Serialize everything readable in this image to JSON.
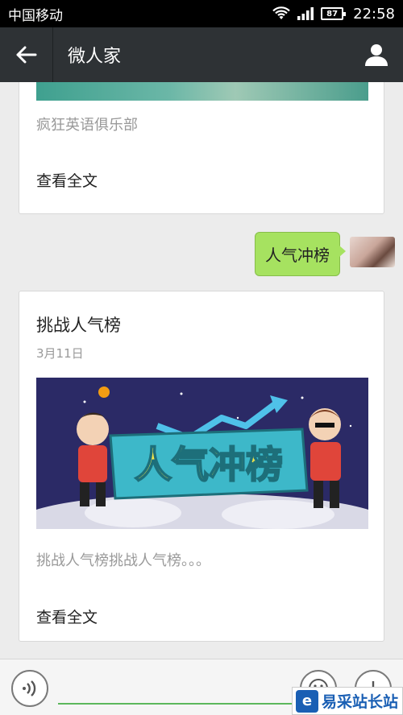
{
  "status_bar": {
    "carrier": "中国移动",
    "battery": "87",
    "time": "22:58"
  },
  "title_bar": {
    "title": "微人家",
    "back_icon": "arrow-left-icon",
    "profile_icon": "person-icon"
  },
  "messages": [
    {
      "type": "article",
      "summary": "疯狂英语俱乐部",
      "read_more": "查看全文"
    },
    {
      "type": "text",
      "sender": "me",
      "text": "人气冲榜"
    },
    {
      "type": "article",
      "title": "挑战人气榜",
      "date": "3月11日",
      "cover_text": "人气冲榜",
      "summary": "挑战人气榜挑战人气榜。。。",
      "read_more": "查看全文"
    }
  ],
  "input_bar": {
    "value": "",
    "voice_icon": "voice-icon",
    "emoji_icon": "emoji-icon",
    "plus_icon": "plus-icon"
  },
  "watermark": {
    "logo": "e",
    "text": "易采站长站"
  },
  "colors": {
    "title_bar": "#2e3235",
    "bubble": "#a6e260",
    "input_underline": "#5cb85c"
  }
}
